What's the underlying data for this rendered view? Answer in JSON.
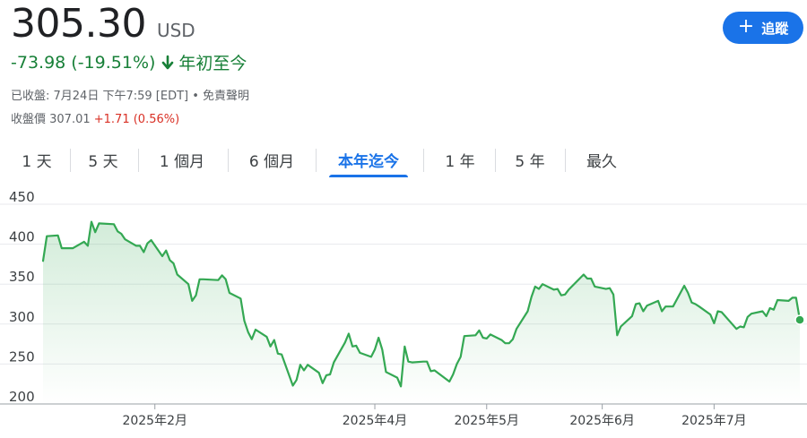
{
  "quote": {
    "price": "305.30",
    "currency": "USD",
    "change_text": "-73.98 (-19.51%)",
    "change_period": "年初至今",
    "close_line": "已收盤: 7月24日 下午7:59 [EDT] • 免責聲明",
    "prev_close_label": "收盤價 307.01",
    "prev_close_change": "+1.71 (0.56%)",
    "down_color": "#188038",
    "up_color": "#d93025"
  },
  "follow_button": {
    "label": "追蹤",
    "icon": "plus-icon",
    "color": "#1a73e8"
  },
  "tabs": [
    {
      "label": "1 天",
      "active": false
    },
    {
      "label": "5 天",
      "active": false
    },
    {
      "label": "1 個月",
      "active": false
    },
    {
      "label": "6 個月",
      "active": false
    },
    {
      "label": "本年迄今",
      "active": true
    },
    {
      "label": "1 年",
      "active": false
    },
    {
      "label": "5 年",
      "active": false
    },
    {
      "label": "最久",
      "active": false
    }
  ],
  "chart_data": {
    "type": "line",
    "line_color": "#34a853",
    "fill": "gradient-green",
    "grid": true,
    "ylim": [
      200,
      450
    ],
    "y_ticks": [
      450,
      400,
      350,
      300,
      250,
      200
    ],
    "x_ticks": [
      {
        "label": "2025年2月",
        "x": "2025-02-01"
      },
      {
        "label": "2025年4月",
        "x": "2025-04-01"
      },
      {
        "label": "2025年5月",
        "x": "2025-05-01"
      },
      {
        "label": "2025年6月",
        "x": "2025-06-01"
      },
      {
        "label": "2025年7月",
        "x": "2025-07-01"
      }
    ],
    "x": [
      "2025-01-02",
      "2025-01-03",
      "2025-01-06",
      "2025-01-07",
      "2025-01-08",
      "2025-01-10",
      "2025-01-13",
      "2025-01-14",
      "2025-01-15",
      "2025-01-16",
      "2025-01-17",
      "2025-01-21",
      "2025-01-22",
      "2025-01-23",
      "2025-01-24",
      "2025-01-27",
      "2025-01-28",
      "2025-01-29",
      "2025-01-30",
      "2025-01-31",
      "2025-02-03",
      "2025-02-04",
      "2025-02-05",
      "2025-02-06",
      "2025-02-07",
      "2025-02-10",
      "2025-02-11",
      "2025-02-12",
      "2025-02-13",
      "2025-02-14",
      "2025-02-18",
      "2025-02-19",
      "2025-02-20",
      "2025-02-21",
      "2025-02-24",
      "2025-02-25",
      "2025-02-26",
      "2025-02-27",
      "2025-02-28",
      "2025-03-03",
      "2025-03-04",
      "2025-03-05",
      "2025-03-06",
      "2025-03-07",
      "2025-03-10",
      "2025-03-11",
      "2025-03-12",
      "2025-03-13",
      "2025-03-14",
      "2025-03-17",
      "2025-03-18",
      "2025-03-19",
      "2025-03-20",
      "2025-03-21",
      "2025-03-24",
      "2025-03-25",
      "2025-03-26",
      "2025-03-27",
      "2025-03-28",
      "2025-03-31",
      "2025-04-01",
      "2025-04-02",
      "2025-04-03",
      "2025-04-04",
      "2025-04-07",
      "2025-04-08",
      "2025-04-09",
      "2025-04-10",
      "2025-04-11",
      "2025-04-14",
      "2025-04-15",
      "2025-04-16",
      "2025-04-17",
      "2025-04-21",
      "2025-04-22",
      "2025-04-23",
      "2025-04-24",
      "2025-04-25",
      "2025-04-28",
      "2025-04-29",
      "2025-04-30",
      "2025-05-01",
      "2025-05-02",
      "2025-05-05",
      "2025-05-06",
      "2025-05-07",
      "2025-05-08",
      "2025-05-09",
      "2025-05-12",
      "2025-05-13",
      "2025-05-14",
      "2025-05-15",
      "2025-05-16",
      "2025-05-19",
      "2025-05-20",
      "2025-05-21",
      "2025-05-22",
      "2025-05-23",
      "2025-05-27",
      "2025-05-28",
      "2025-05-29",
      "2025-05-30",
      "2025-06-02",
      "2025-06-03",
      "2025-06-04",
      "2025-06-05",
      "2025-06-06",
      "2025-06-09",
      "2025-06-10",
      "2025-06-11",
      "2025-06-12",
      "2025-06-13",
      "2025-06-16",
      "2025-06-17",
      "2025-06-18",
      "2025-06-20",
      "2025-06-23",
      "2025-06-24",
      "2025-06-25",
      "2025-06-26",
      "2025-06-27",
      "2025-06-30",
      "2025-07-01",
      "2025-07-02",
      "2025-07-03",
      "2025-07-07",
      "2025-07-08",
      "2025-07-09",
      "2025-07-10",
      "2025-07-11",
      "2025-07-14",
      "2025-07-15",
      "2025-07-16",
      "2025-07-17",
      "2025-07-18",
      "2025-07-21",
      "2025-07-22",
      "2025-07-23",
      "2025-07-24"
    ],
    "values": [
      379,
      410,
      411,
      395,
      395,
      395,
      403,
      398,
      428,
      415,
      426,
      425,
      416,
      413,
      406,
      398,
      398,
      390,
      401,
      405,
      385,
      392,
      380,
      376,
      362,
      350,
      329,
      336,
      356,
      356,
      355,
      361,
      356,
      339,
      332,
      304,
      290,
      281,
      293,
      284,
      272,
      280,
      263,
      262,
      223,
      230,
      249,
      242,
      249,
      239,
      226,
      236,
      237,
      252,
      277,
      288,
      272,
      273,
      264,
      259,
      268,
      283,
      268,
      240,
      233,
      222,
      272,
      253,
      252,
      253,
      253,
      241,
      242,
      228,
      237,
      250,
      259,
      285,
      286,
      292,
      283,
      282,
      287,
      280,
      276,
      276,
      281,
      294,
      316,
      334,
      347,
      344,
      350,
      343,
      344,
      336,
      337,
      343,
      362,
      357,
      357,
      347,
      344,
      345,
      337,
      286,
      297,
      310,
      325,
      326,
      316,
      323,
      329,
      316,
      322,
      322,
      348,
      339,
      327,
      325,
      322,
      312,
      301,
      316,
      315,
      294,
      297,
      296,
      309,
      313,
      316,
      310,
      320,
      318,
      330,
      329,
      333,
      333,
      305.3
    ]
  }
}
